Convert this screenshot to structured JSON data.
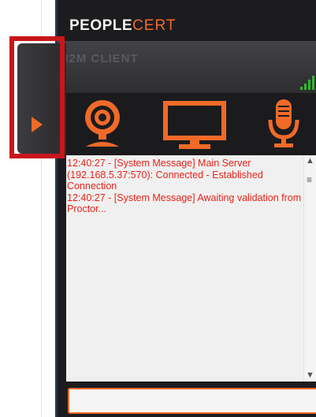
{
  "brand": {
    "part1": "PEOPLE",
    "part2": "CERT"
  },
  "client_title": "M2M CLIENT",
  "colors": {
    "accent": "#f06a28",
    "highlight": "#c8161b",
    "log_text": "#e8231a",
    "panel_bg": "#1c1c1f"
  },
  "icons": {
    "webcam": "webcam-icon",
    "screen": "monitor-icon",
    "mic": "microphone-icon",
    "signal": "signal-strength-icon",
    "expand": "play-arrow-icon"
  },
  "log": {
    "lines": [
      "12:40:27 - [System Message] Main Server (192.168.5.37:570): Connected - Established Connection",
      "12:40:27 - [System Message] Awaiting validation from Proctor..."
    ]
  },
  "chat_input": {
    "value": ""
  }
}
